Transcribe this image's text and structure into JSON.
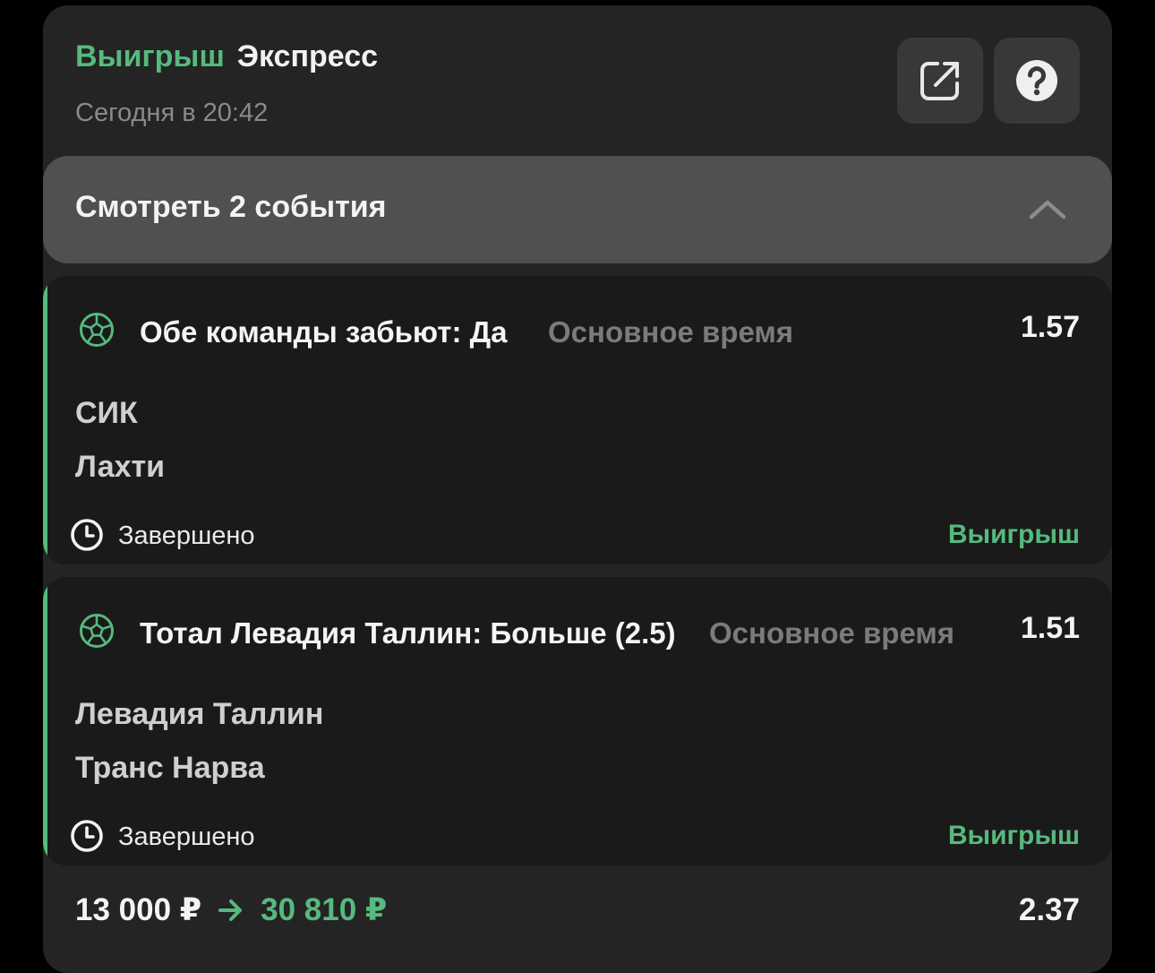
{
  "header": {
    "status": "Выигрыш",
    "bet_type": "Экспресс",
    "date": "Сегодня в 20:42",
    "share_icon": "share-icon",
    "help_icon": "help-icon"
  },
  "expand": {
    "label": "Смотреть 2 события",
    "icon": "chevron-up-icon"
  },
  "events": [
    {
      "sport_icon": "football-icon",
      "market": "Обе команды забьют: Да",
      "period": "Основное время",
      "odd": "1.57",
      "team1": "СИК",
      "team2": "Лахти",
      "state": "Завершено",
      "result": "Выигрыш"
    },
    {
      "sport_icon": "football-icon",
      "market": "Тотал Левадия Таллин: Больше (2.5)",
      "period": "Основное время",
      "odd": "1.51",
      "team1": "Левадия Таллин",
      "team2": "Транс Нарва",
      "state": "Завершено",
      "result": "Выигрыш"
    }
  ],
  "footer": {
    "stake": "13 000 ₽",
    "payout": "30 810 ₽",
    "total_odd": "2.37"
  },
  "colors": {
    "background": "#000000",
    "card": "#242424",
    "event_bg": "#1a1a1a",
    "expand_bg": "#505050",
    "accent": "#57b97e",
    "muted": "#7b7b7b"
  }
}
